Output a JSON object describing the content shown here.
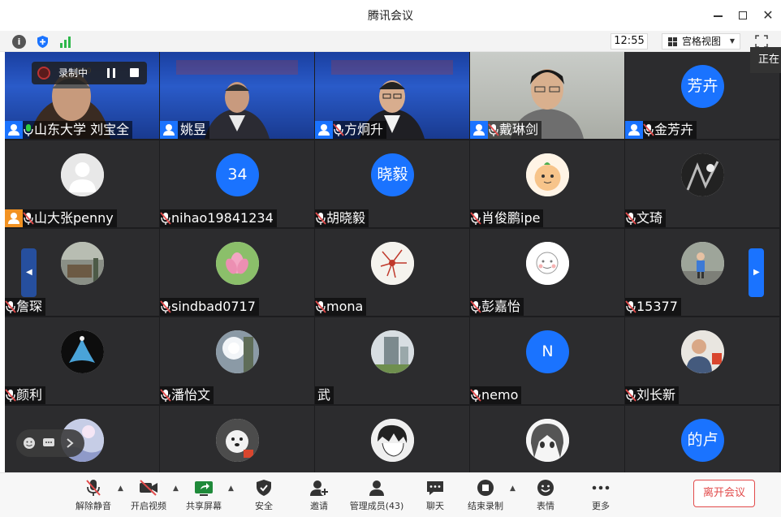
{
  "window": {
    "title": "腾讯会议"
  },
  "infobar": {
    "time": "12:55",
    "view_mode": "宫格视图"
  },
  "recording": {
    "label": "录制中"
  },
  "speaking_label": "正在",
  "participants": [
    {
      "name": "山东大学 刘宝全",
      "kind": "video-blue",
      "mic": "on"
    },
    {
      "name": "姚昱",
      "kind": "video-blue",
      "mic": "none"
    },
    {
      "name": "方炯升",
      "kind": "video-blue",
      "mic": "muted"
    },
    {
      "name": "戴琳剑",
      "kind": "video-room",
      "mic": "muted"
    },
    {
      "name": "金芳卉",
      "kind": "text",
      "avatar_text": "芳卉",
      "mic": "muted"
    },
    {
      "name": "山大张penny",
      "kind": "default",
      "mic": "muted",
      "host_orange": true
    },
    {
      "name": "nihao19841234",
      "kind": "text",
      "avatar_text": "34",
      "mic": "muted"
    },
    {
      "name": "胡晓毅",
      "kind": "text",
      "avatar_text": "晓毅",
      "mic": "muted"
    },
    {
      "name": "肖俊鹏ipe",
      "kind": "img-cartoon",
      "mic": "muted"
    },
    {
      "name": "文琦",
      "kind": "img-dark",
      "mic": "muted"
    },
    {
      "name": "詹琛",
      "kind": "img-room",
      "mic": "muted"
    },
    {
      "name": "sindbad0717",
      "kind": "img-lotus",
      "mic": "muted"
    },
    {
      "name": "mona",
      "kind": "img-flower",
      "mic": "muted"
    },
    {
      "name": "彭嘉怡",
      "kind": "img-sketch",
      "mic": "muted"
    },
    {
      "name": "15377",
      "kind": "img-child",
      "mic": "muted"
    },
    {
      "name": "颜利",
      "kind": "img-dancer",
      "mic": "muted"
    },
    {
      "name": "潘怡文",
      "kind": "img-sun",
      "mic": "muted"
    },
    {
      "name": "武",
      "kind": "img-building",
      "mic": "none"
    },
    {
      "name": "nemo",
      "kind": "text",
      "avatar_text": "N",
      "mic": "muted"
    },
    {
      "name": "刘长新",
      "kind": "img-person",
      "mic": "muted"
    },
    {
      "name": "",
      "kind": "img-sky",
      "mic": "none"
    },
    {
      "name": "",
      "kind": "img-dog",
      "mic": "none"
    },
    {
      "name": "",
      "kind": "img-anime",
      "mic": "none"
    },
    {
      "name": "",
      "kind": "img-anime2",
      "mic": "none"
    },
    {
      "name": "",
      "kind": "text",
      "avatar_text": "的卢",
      "mic": "none"
    }
  ],
  "toolbar": {
    "unmute": "解除静音",
    "video": "开启视频",
    "share": "共享屏幕",
    "security": "安全",
    "invite": "邀请",
    "members": "管理成员(43)",
    "chat": "聊天",
    "end_record": "结束录制",
    "reaction": "表情",
    "more": "更多",
    "leave": "离开会议"
  }
}
